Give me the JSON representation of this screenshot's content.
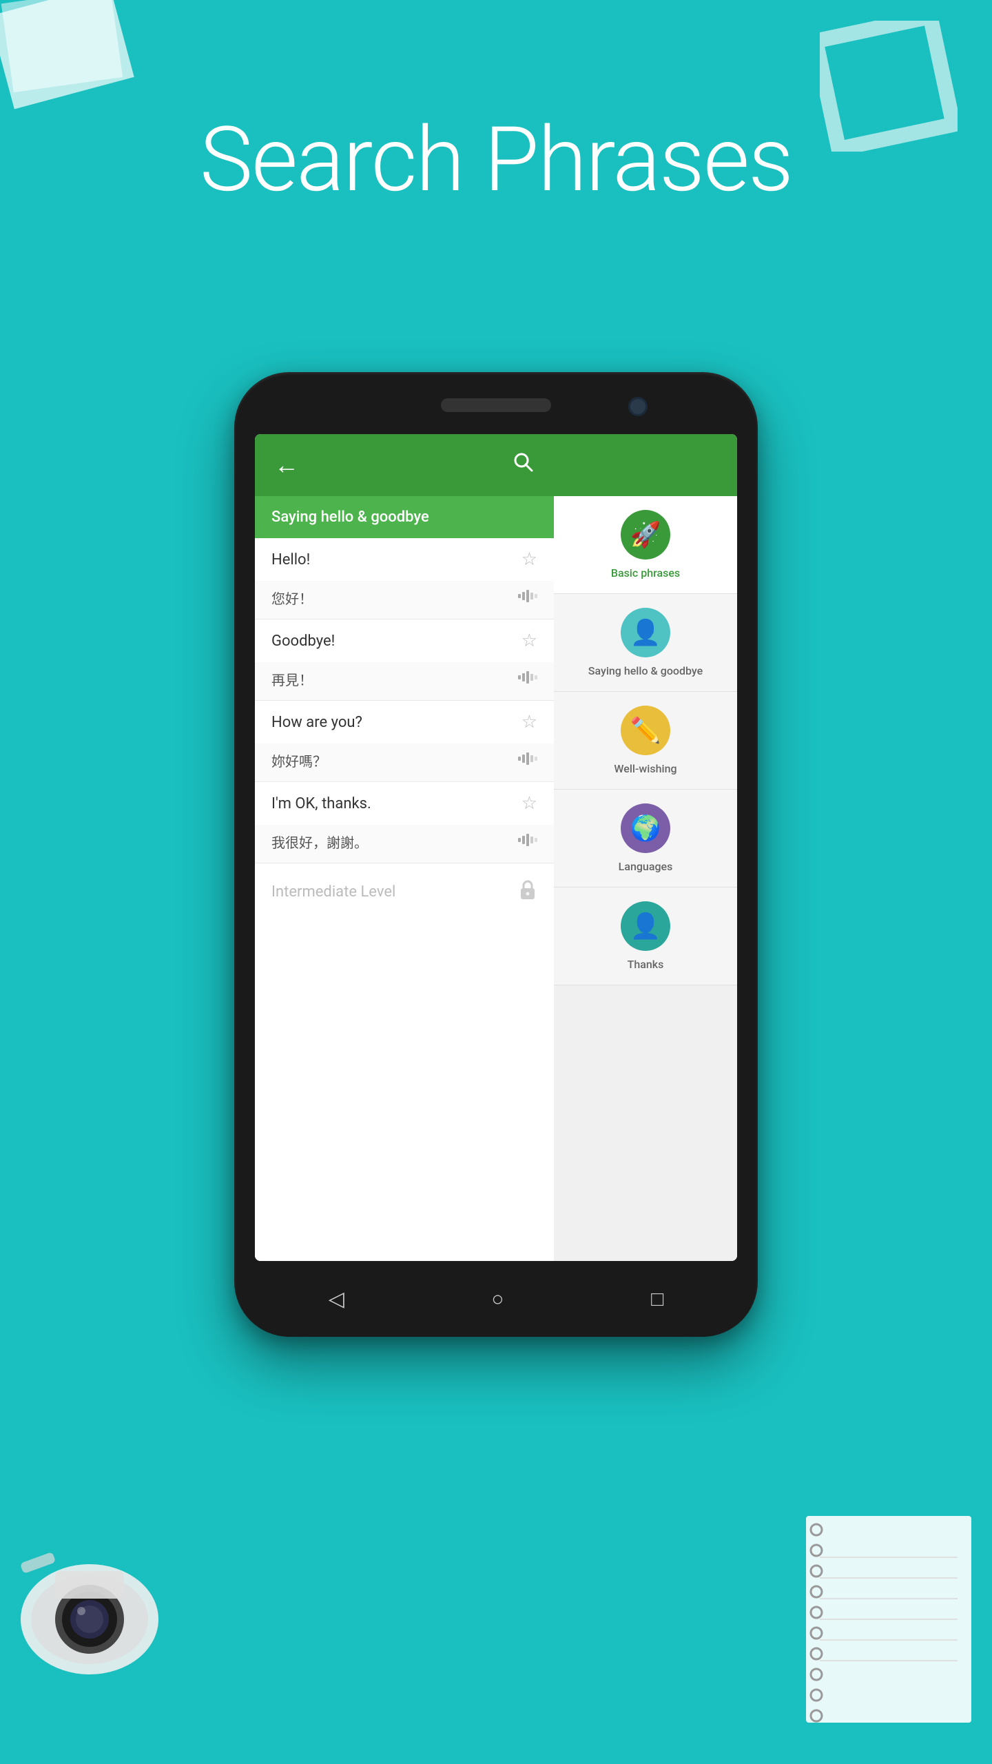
{
  "page": {
    "background_color": "#1ABFBF",
    "title": "Search Phrases"
  },
  "header": {
    "back_label": "←",
    "search_label": "🔍"
  },
  "app": {
    "category_title": "Saying hello & goodbye",
    "phrases": [
      {
        "english": "Hello!",
        "translation": "您好！",
        "has_star": true,
        "has_audio": true
      },
      {
        "english": "Goodbye!",
        "translation": "再見！",
        "has_star": true,
        "has_audio": true
      },
      {
        "english": "How are you?",
        "translation": "妳好嗎？",
        "has_star": true,
        "has_audio": true
      },
      {
        "english": "I'm OK, thanks.",
        "translation": "我很好，謝謝。",
        "has_star": true,
        "has_audio": true
      }
    ],
    "intermediate_label": "Intermediate Level",
    "nav": {
      "back": "◁",
      "home": "○",
      "recent": "□"
    },
    "categories": [
      {
        "name": "Basic phrases",
        "icon": "🚀",
        "color": "green",
        "active": true
      },
      {
        "name": "Saying hello & goodbye",
        "icon": "👤",
        "color": "teal",
        "active": false
      },
      {
        "name": "Well-wishing",
        "icon": "✏️",
        "color": "orange",
        "active": false
      },
      {
        "name": "Languages",
        "icon": "🌍",
        "color": "purple",
        "active": false
      },
      {
        "name": "Thanks",
        "icon": "👤",
        "color": "blue-green",
        "active": false
      }
    ]
  }
}
